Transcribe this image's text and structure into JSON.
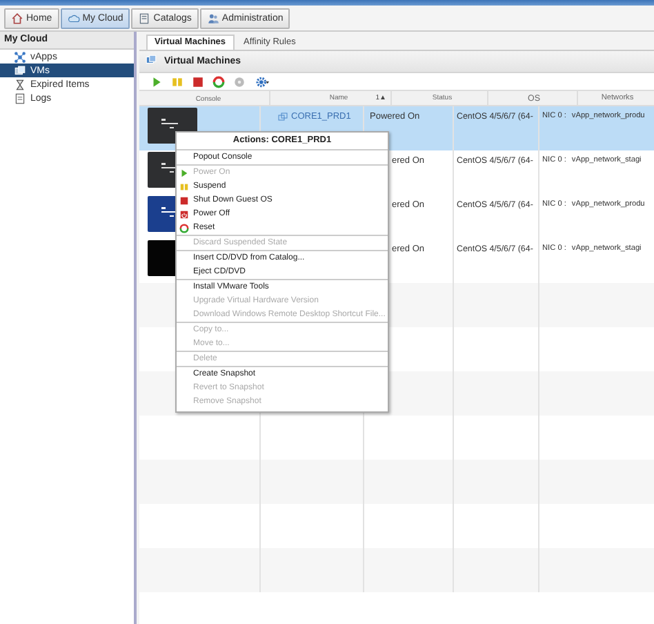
{
  "nav_tabs": [
    {
      "label": "Home",
      "selected": false
    },
    {
      "label": "My Cloud",
      "selected": true
    },
    {
      "label": "Catalogs",
      "selected": false
    },
    {
      "label": "Administration",
      "selected": false
    }
  ],
  "sidebar": {
    "title": "My Cloud",
    "items": [
      {
        "label": "vApps",
        "selected": false
      },
      {
        "label": "VMs",
        "selected": true
      },
      {
        "label": "Expired Items",
        "selected": false
      },
      {
        "label": "Logs",
        "selected": false
      }
    ]
  },
  "sub_tabs": [
    {
      "label": "Virtual Machines",
      "selected": true
    },
    {
      "label": "Affinity Rules",
      "selected": false
    }
  ],
  "panel_title": "Virtual Machines",
  "table": {
    "columns": [
      {
        "label": "Console"
      },
      {
        "label": "Name",
        "sort": "1▲"
      },
      {
        "label": "Status"
      },
      {
        "label": "OS"
      },
      {
        "label": "Networks"
      }
    ],
    "rows": [
      {
        "name": "CORE1_PRD1",
        "status": "Powered On",
        "os": "CentOS 4/5/6/7 (64-",
        "nic": "NIC 0 :",
        "network": "vApp_network_produ",
        "selected": true
      },
      {
        "status": "ered On",
        "os": "CentOS 4/5/6/7 (64-",
        "nic": "NIC 0 :",
        "network": "vApp_network_stagi",
        "selected": false
      },
      {
        "status": "ered On",
        "os": "CentOS 4/5/6/7 (64-",
        "nic": "NIC 0 :",
        "network": "vApp_network_produ",
        "selected": false
      },
      {
        "status": "ered On",
        "os": "CentOS 4/5/6/7 (64-",
        "nic": "NIC 0 :",
        "network": "vApp_network_stagi",
        "selected": false
      }
    ]
  },
  "context_menu": {
    "title": "Actions: CORE1_PRD1",
    "items": [
      {
        "label": "Popout Console",
        "disabled": false,
        "divider_before": false
      },
      {
        "label": "Power On",
        "disabled": true,
        "divider_before": true
      },
      {
        "label": "Suspend",
        "disabled": false,
        "divider_before": false
      },
      {
        "label": "Shut Down Guest OS",
        "disabled": false,
        "divider_before": false
      },
      {
        "label": "Power Off",
        "disabled": false,
        "divider_before": false
      },
      {
        "label": "Reset",
        "disabled": false,
        "divider_before": false
      },
      {
        "label": "Discard Suspended State",
        "disabled": true,
        "divider_before": true
      },
      {
        "label": "Insert CD/DVD from Catalog...",
        "disabled": false,
        "divider_before": true
      },
      {
        "label": "Eject CD/DVD",
        "disabled": false,
        "divider_before": false
      },
      {
        "label": "Install VMware Tools",
        "disabled": false,
        "divider_before": true
      },
      {
        "label": "Upgrade Virtual Hardware Version",
        "disabled": true,
        "divider_before": false
      },
      {
        "label": "Download Windows Remote Desktop Shortcut File...",
        "disabled": true,
        "divider_before": false
      },
      {
        "label": "Copy to...",
        "disabled": true,
        "divider_before": true
      },
      {
        "label": "Move to...",
        "disabled": true,
        "divider_before": false
      },
      {
        "label": "Delete",
        "disabled": true,
        "divider_before": true
      },
      {
        "label": "Create Snapshot",
        "disabled": false,
        "divider_before": true
      },
      {
        "label": "Revert to Snapshot",
        "disabled": true,
        "divider_before": false
      },
      {
        "label": "Remove Snapshot",
        "disabled": true,
        "divider_before": false
      }
    ]
  }
}
